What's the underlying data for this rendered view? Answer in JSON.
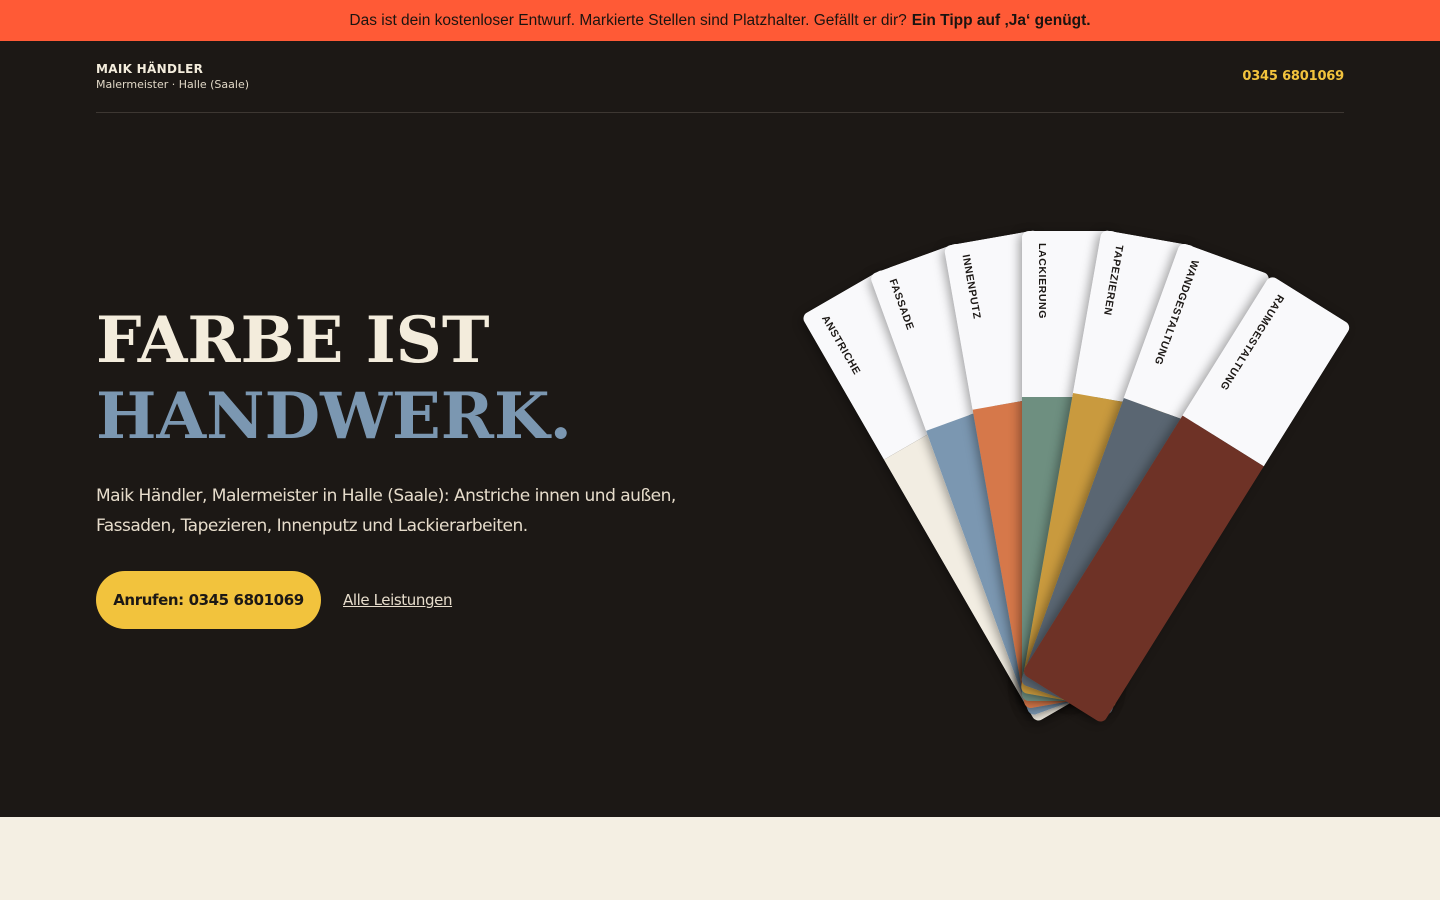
{
  "banner": {
    "text": "Das ist dein kostenloser Entwurf. Markierte Stellen sind Platzhalter. Gefällt er dir?",
    "link": "Ein Tipp auf ‚Ja‘ genügt."
  },
  "header": {
    "name": "MAIK HÄNDLER",
    "subtitle": "Malermeister · Halle (Saale)",
    "phone": "0345 6801069"
  },
  "hero": {
    "line1": "FARBE IST",
    "line2": "HANDWERK.",
    "intro": "Maik Händler, Malermeister in Halle (Saale): Anstriche innen und außen, Fassaden, Tapezieren, Innenputz und Lackierarbeiten.",
    "cta_label": "Anrufen: 0345 6801069",
    "more_label": "Alle Leistungen"
  },
  "swatches": [
    {
      "label": "ANSTRICHE",
      "color": "#f2ede2"
    },
    {
      "label": "FASSADE",
      "color": "#7b97b1"
    },
    {
      "label": "INNENPUTZ",
      "color": "#d6784a"
    },
    {
      "label": "LACKIERUNG",
      "color": "#6e8f80"
    },
    {
      "label": "TAPEZIEREN",
      "color": "#c99a3e"
    },
    {
      "label": "WANDGESTALTUNG",
      "color": "#5a6672"
    },
    {
      "label": "RAUMGESTALTUNG",
      "color": "#6e3226"
    }
  ]
}
